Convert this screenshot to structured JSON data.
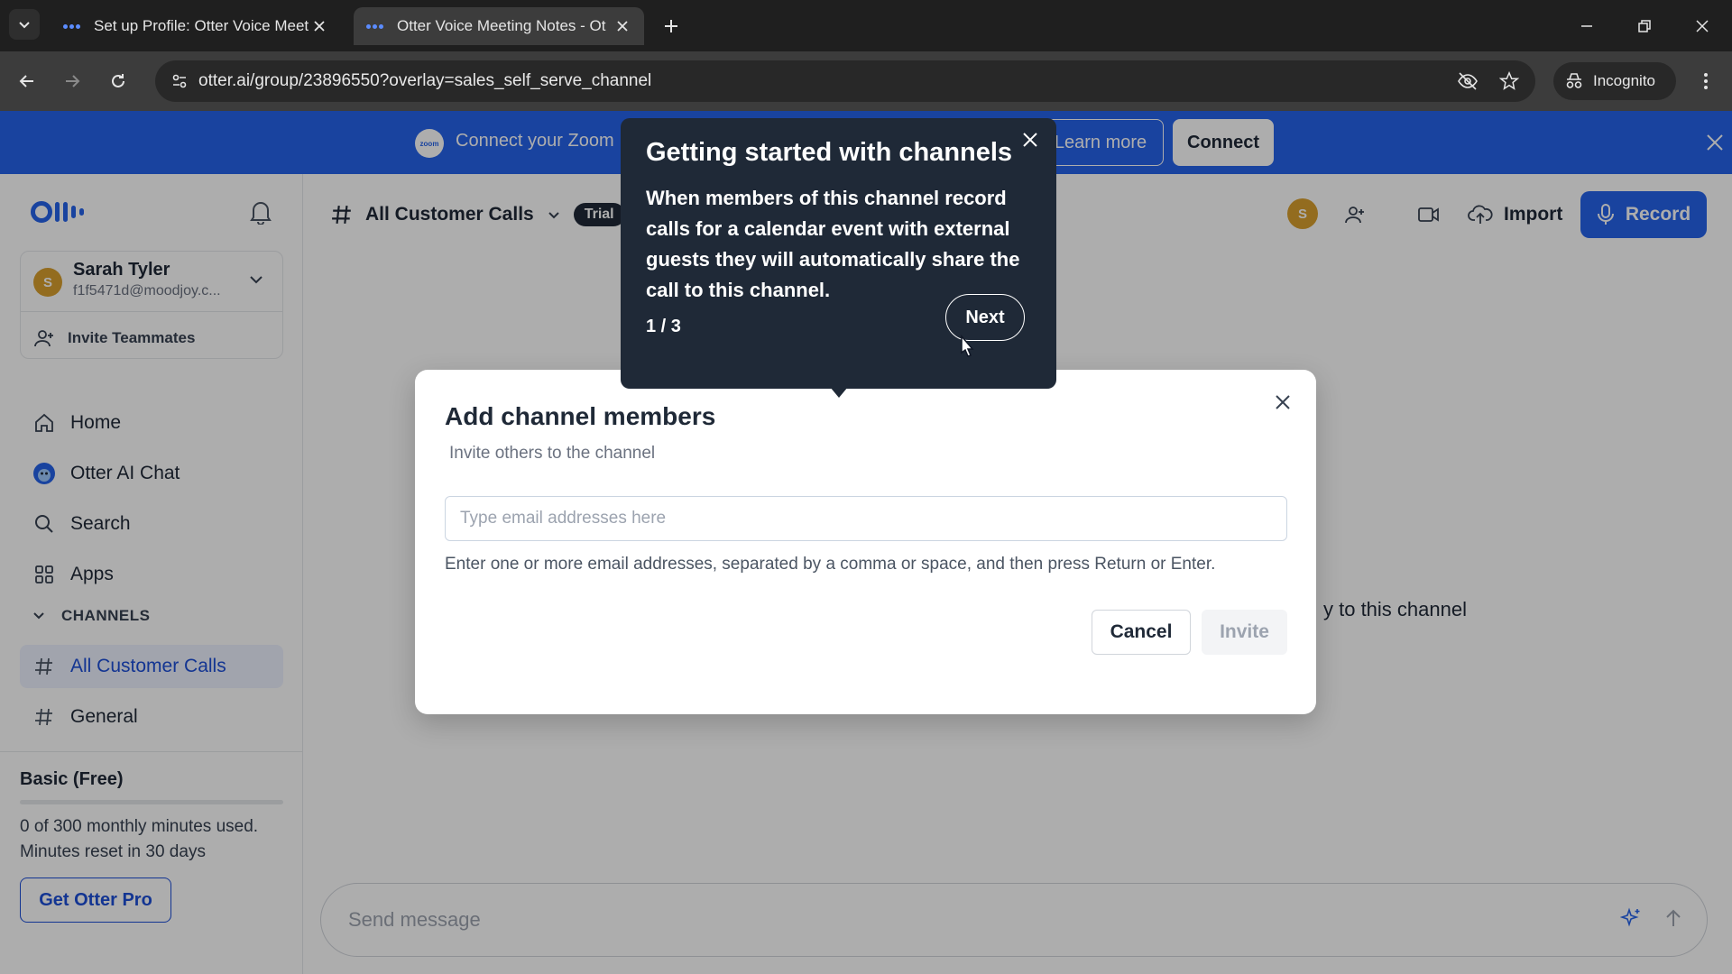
{
  "browser": {
    "tabs": [
      {
        "title": "Set up Profile: Otter Voice Meet",
        "active": false
      },
      {
        "title": "Otter Voice Meeting Notes - Ot",
        "active": true
      }
    ],
    "url": "otter.ai/group/23896550?overlay=sales_self_serve_channel",
    "incognito_label": "Incognito"
  },
  "banner": {
    "logo_text": "zoom",
    "text": "Connect your Zoom",
    "learn_more": "Learn more",
    "connect": "Connect"
  },
  "sidebar": {
    "user": {
      "initial": "S",
      "name": "Sarah Tyler",
      "email": "f1f5471d@moodjoy.c..."
    },
    "invite_label": "Invite Teammates",
    "nav": [
      {
        "label": "Home",
        "icon": "home-icon"
      },
      {
        "label": "Otter AI Chat",
        "icon": "otter-chat-icon"
      },
      {
        "label": "Search",
        "icon": "search-icon"
      },
      {
        "label": "Apps",
        "icon": "apps-icon"
      }
    ],
    "channels_header": "CHANNELS",
    "channels": [
      {
        "label": "All Customer Calls",
        "selected": true
      },
      {
        "label": "General",
        "selected": false
      }
    ],
    "plan": {
      "name": "Basic (Free)",
      "usage_line1": "0 of 300 monthly minutes used.",
      "usage_line2": "Minutes reset in 30 days",
      "used_fraction": 0,
      "cta": "Get Otter Pro"
    }
  },
  "header": {
    "channel_name": "All Customer Calls",
    "badge": "Trial",
    "avatar_initial": "S",
    "import_label": "Import",
    "record_label": "Record"
  },
  "main": {
    "background_text": "y to this channel",
    "message_placeholder": "Send message"
  },
  "modal": {
    "title": "Add channel members",
    "subtitle": "Invite others to the channel",
    "input_placeholder": "Type email addresses here",
    "input_value": "",
    "help": "Enter one or more email addresses, separated by a comma or space, and then press Return or Enter.",
    "cancel": "Cancel",
    "invite": "Invite"
  },
  "tour": {
    "title": "Getting started with channels",
    "body": "When members of this channel record calls for a calendar event with external guests they will automatically share the call to this channel.",
    "step": "1 / 3",
    "next": "Next"
  },
  "colors": {
    "accent": "#2563eb",
    "tooltip_bg": "#1f2937",
    "avatar": "#d9a02e"
  }
}
